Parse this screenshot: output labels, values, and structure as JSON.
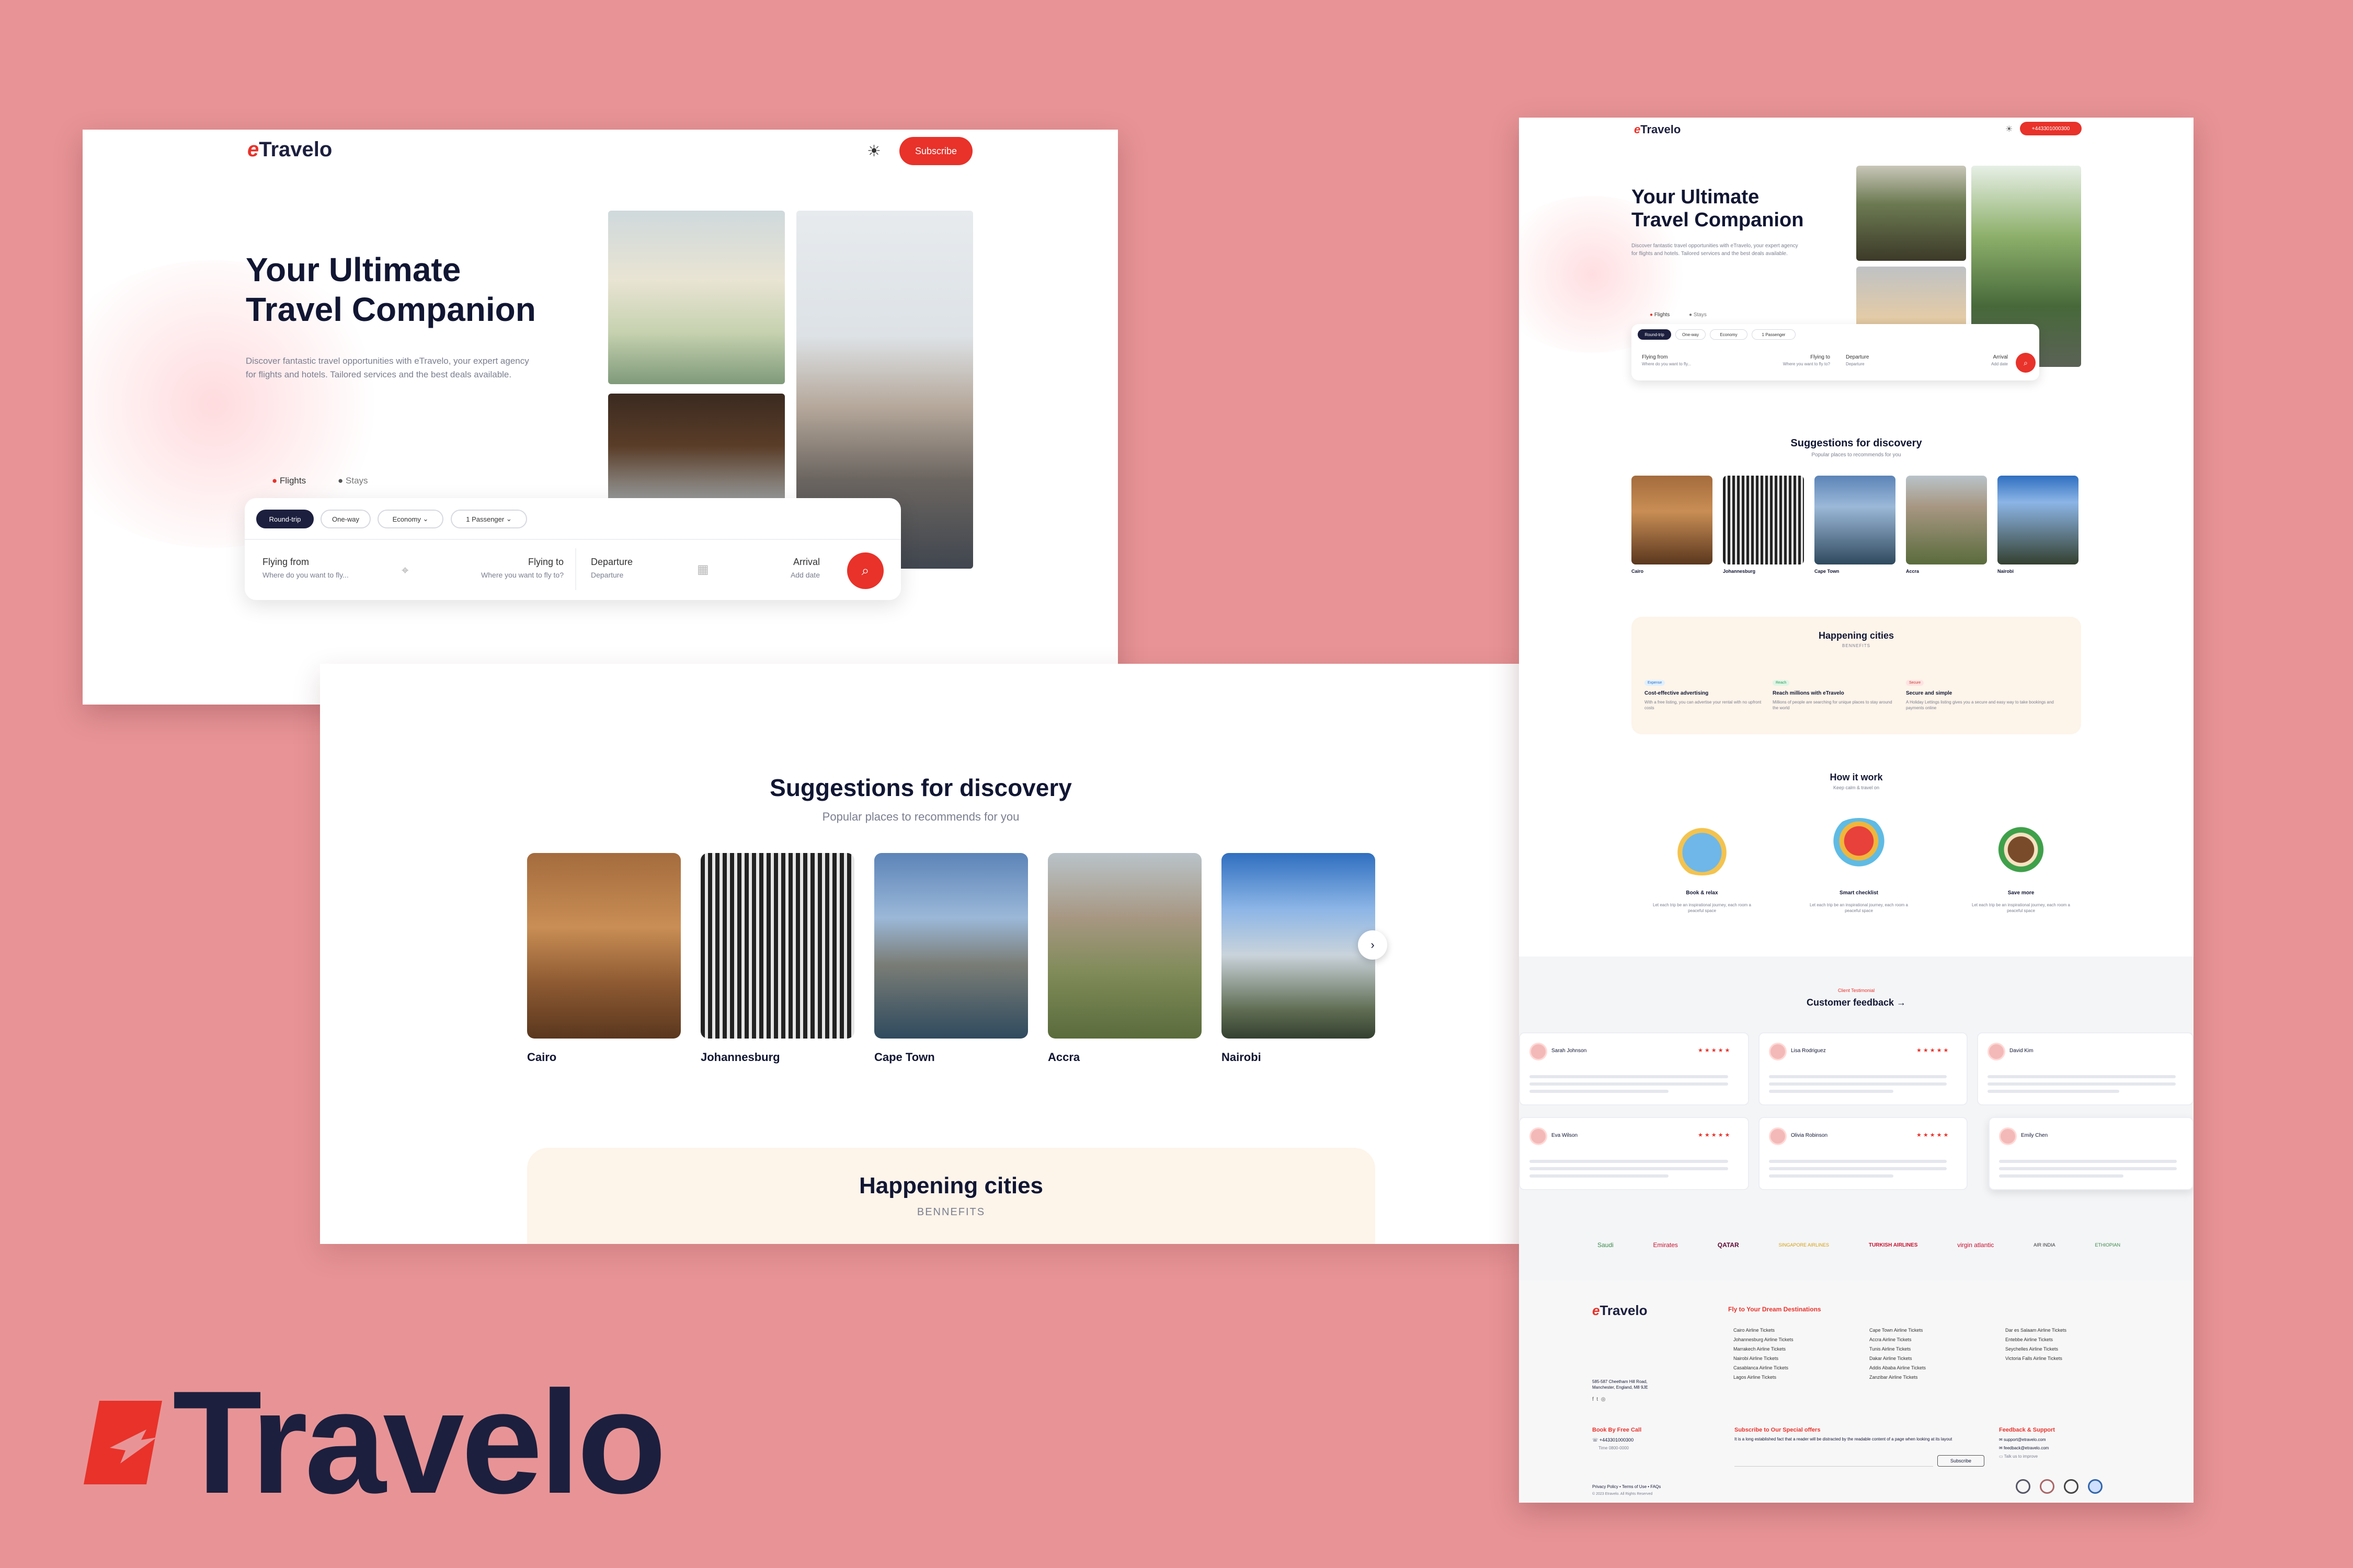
{
  "brand": {
    "logo_mark": "e",
    "logo_word": "Travelo",
    "accent": "#e8322a",
    "navy": "#1c1f3e",
    "bg": "#e89496"
  },
  "hero": {
    "subscribe_label": "Subscribe",
    "title_line1": "Your Ultimate",
    "title_line2": "Travel Companion",
    "subtitle_line1": "Discover fantastic travel opportunities with eTravelo, your expert agency",
    "subtitle_line2": "for flights and hotels. Tailored services and the best deals available.",
    "tabs": [
      "Flights",
      "Stays"
    ],
    "chips": [
      "Round-trip",
      "One-way",
      "Economy",
      "1 Passenger"
    ],
    "fields": {
      "from_label": "Flying from",
      "from_placeholder": "Where do you want to fly...",
      "to_label": "Flying to",
      "to_placeholder": "Where you want to fly to?",
      "dep_label": "Departure",
      "dep_placeholder": "Departure",
      "arr_label": "Arrival",
      "arr_placeholder": "Add date"
    }
  },
  "discovery": {
    "title": "Suggestions for discovery",
    "subtitle": "Popular places to recommends for you",
    "cities": [
      "Cairo",
      "Johannesburg",
      "Cape Town",
      "Accra",
      "Nairobi"
    ]
  },
  "happening": {
    "title": "Happening cities",
    "subtitle": "BENNEFITS"
  },
  "right": {
    "phone_label": "+443301000300",
    "benefits": [
      {
        "tag": "Expense",
        "title": "Cost-effective advertising",
        "text": "With a free listing, you can advertise your rental with no upfront costs"
      },
      {
        "tag": "Reach",
        "title": "Reach millions with eTravelo",
        "text": "Millions of people are searching for unique places to stay around the world"
      },
      {
        "tag": "Secure",
        "title": "Secure and simple",
        "text": "A Holiday Lettings listing gives you a secure and easy way to take bookings and payments online"
      }
    ],
    "how_title": "How it work",
    "how_subtitle": "Keep calm & travel on",
    "how_steps": [
      {
        "title": "Book & relax",
        "text": "Let each trip be an inspirational journey, each room a peaceful space"
      },
      {
        "title": "Smart checklist",
        "text": "Let each trip be an inspirational journey, each room a peaceful space"
      },
      {
        "title": "Save more",
        "text": "Let each trip be an inspirational journey, each room a peaceful space"
      }
    ],
    "testimonial_tag": "Client Testimonial",
    "testimonial_title": "Customer feedback →",
    "reviewers": [
      "Sarah Johnson",
      "Lisa Rodriguez",
      "David Kim",
      "Eva Wilson",
      "Olivia Robinson",
      "Emily Chen"
    ],
    "stars": "★★★★★",
    "airlines": [
      "Saudi",
      "Emirates",
      "QATAR",
      "SINGAPORE AIRLINES",
      "TURKISH AIRLINES",
      "virgin atlantic",
      "AIR INDIA",
      "ETHIOPIAN"
    ],
    "footer": {
      "dream_title": "Fly to Your Dream Destinations",
      "col1": [
        "Cairo Airline Tickets",
        "Johannesburg Airline Tickets",
        "Marrakech Airline Tickets",
        "Nairobi Airline Tickets",
        "Casablanca Airline Tickets",
        "Lagos Airline Tickets"
      ],
      "col2": [
        "Cape Town Airline Tickets",
        "Accra Airline Tickets",
        "Tunis Airline Tickets",
        "Dakar Airline Tickets",
        "Addis Ababa Airline Tickets",
        "Zanzibar Airline Tickets"
      ],
      "col3": [
        "Dar es Salaam Airline Tickets",
        "Entebbe Airline Tickets",
        "Seychelles Airline Tickets",
        "Victoria Falls Airline Tickets"
      ],
      "address": "585-587 Cheetham Hill Road, Manchester, England, M8 9JE",
      "call_title": "Book By Free Call",
      "phone": "+443301000300",
      "time": "Time 0800-0000",
      "offers_title": "Subscribe to Our Special offers",
      "offers_text": "It is a long established fact that a reader will be distracted by the readable content of a page when looking at its layout",
      "subscribe_label": "Subscribe",
      "support_title": "Feedback & Support",
      "support_email": "support@etravelo.com",
      "feedback_email": "feedback@etravelo.com",
      "chat_label": "Talk us to improve",
      "legal": "Privacy Policy • Terms of Use • FAQs",
      "copyright": "© 2023 Etravelo. All Rights Reserved"
    }
  }
}
